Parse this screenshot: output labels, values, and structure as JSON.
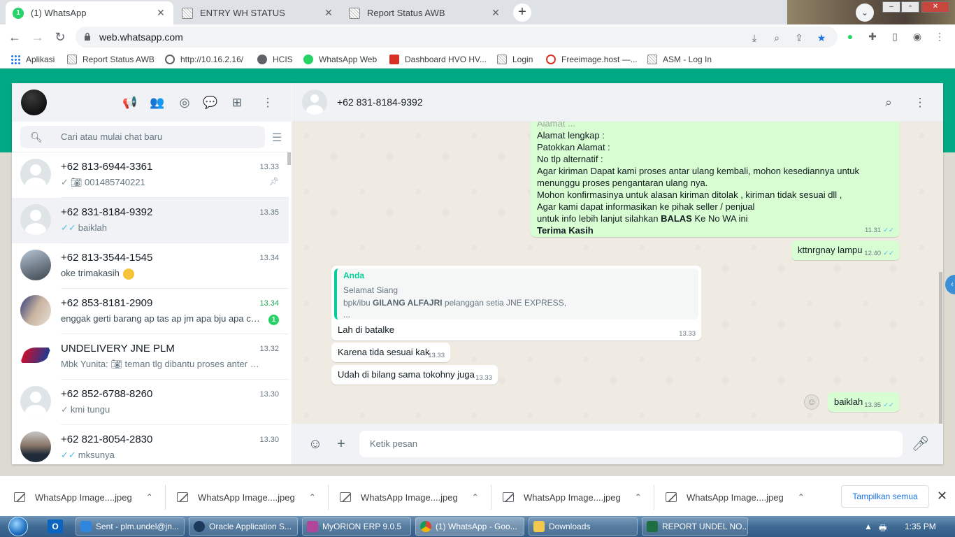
{
  "browser": {
    "tabs": [
      {
        "label": "(1) WhatsApp",
        "icon": "whatsapp-icon",
        "badge": "1"
      },
      {
        "label": "ENTRY WH STATUS",
        "icon": "document-icon"
      },
      {
        "label": "Report Status AWB",
        "icon": "document-icon"
      }
    ],
    "url": "web.whatsapp.com",
    "bookmarks": [
      {
        "label": "Aplikasi",
        "icon": "apps-grid-icon"
      },
      {
        "label": "Report Status AWB",
        "icon": "document-icon"
      },
      {
        "label": "http://10.16.2.16/",
        "icon": "globe-icon"
      },
      {
        "label": "HCIS",
        "icon": "hcis-icon"
      },
      {
        "label": "WhatsApp Web",
        "icon": "whatsapp-icon"
      },
      {
        "label": "Dashboard HVO HV...",
        "icon": "dashboard-icon"
      },
      {
        "label": "Login",
        "icon": "document-icon"
      },
      {
        "label": "Freeimage.host —...",
        "icon": "freeimage-icon"
      },
      {
        "label": "ASM - Log In",
        "icon": "document-icon"
      }
    ]
  },
  "sidebar": {
    "search_placeholder": "Cari atau mulai chat baru",
    "chats": [
      {
        "name": "+62 813-6944-3361",
        "time": "13.33",
        "tick": "✓",
        "preview": "001485740221",
        "has_camera": true,
        "pinned": true
      },
      {
        "name": "+62 831-8184-9392",
        "time": "13.35",
        "tick": "✓✓",
        "preview": "baiklah",
        "selected": true
      },
      {
        "name": "+62 813-3544-1545",
        "time": "13.34",
        "preview": "oke trimakasih",
        "emoji": "☺"
      },
      {
        "name": "+62 853-8181-2909",
        "time": "13.34",
        "preview": "enggak gerti barang ap tas ap jm apa bju apa cel...",
        "unread": "1"
      },
      {
        "name": "UNDELIVERY JNE PLM",
        "time": "13.32",
        "sender": "Mbk Yunita:",
        "preview": "teman tlg dibantu proses anter ulang ..."
      },
      {
        "name": "+62 852-6788-8260",
        "time": "13.30",
        "tick": "✓",
        "preview": "kmi tungu"
      },
      {
        "name": "+62 821-8054-2830",
        "time": "13.30",
        "tick": "✓✓",
        "preview": "mksunya"
      }
    ]
  },
  "conversation": {
    "contact": "+62 831-8184-9392",
    "long_message": {
      "lines": [
        "Alamat  lengkap :",
        "Patokkan Alamat :",
        "No tlp alternatif :",
        "Agar kiriman Dapat kami proses antar ulang kembali, mohon kesediannya untuk",
        "menunggu proses pengantaran ulang nya.",
        "Mohon konfirmasinya untuk alasan kiriman ditolak , kiriman tidak sesuai dll ,",
        "Agar kami dapat informasikan ke pihak seller / penjual"
      ],
      "balas_prefix": "untuk info lebih lanjut silahkan ",
      "balas_bold": "BALAS",
      "balas_suffix": " Ke No WA ini",
      "closing": "Terima Kasih",
      "time": "11.31"
    },
    "messages": [
      {
        "dir": "out",
        "text": "kttnrgnay lampu",
        "time": "12.40"
      },
      {
        "dir": "in",
        "quote_author": "Anda",
        "quote_line1": "Selamat Siang",
        "quote_line2_pre": " bpk/ibu ",
        "quote_line2_bold": "GILANG ALFAJRI",
        "quote_line2_post": " pelanggan setia JNE EXPRESS,",
        "quote_line3": "...",
        "text": "Lah di batalke",
        "time": "13.33"
      },
      {
        "dir": "in",
        "text": "Karena tida sesuai kak",
        "time": "13.33"
      },
      {
        "dir": "in",
        "text": "Udah di bilang sama tokohny juga",
        "time": "13.33"
      },
      {
        "dir": "out",
        "text": "baiklah",
        "time": "13.35"
      }
    ],
    "composer_placeholder": "Ketik pesan"
  },
  "downloads": {
    "items": [
      "WhatsApp Image....jpeg",
      "WhatsApp Image....jpeg",
      "WhatsApp Image....jpeg",
      "WhatsApp Image....jpeg",
      "WhatsApp Image....jpeg"
    ],
    "show_all": "Tampilkan semua"
  },
  "taskbar": {
    "items": [
      {
        "label": "Sent - plm.undel@jn..."
      },
      {
        "label": "Oracle Application S..."
      },
      {
        "label": "MyORION ERP 9.0.5"
      },
      {
        "label": "(1) WhatsApp - Goo...",
        "active": true
      },
      {
        "label": "Downloads"
      },
      {
        "label": "REPORT UNDEL NO..."
      }
    ],
    "clock": "1:35 PM"
  },
  "colors": {
    "whatsapp_green": "#00a884",
    "outgoing_bubble": "#d9fdd3",
    "read_tick": "#53bdeb",
    "unread_badge": "#25d366"
  }
}
